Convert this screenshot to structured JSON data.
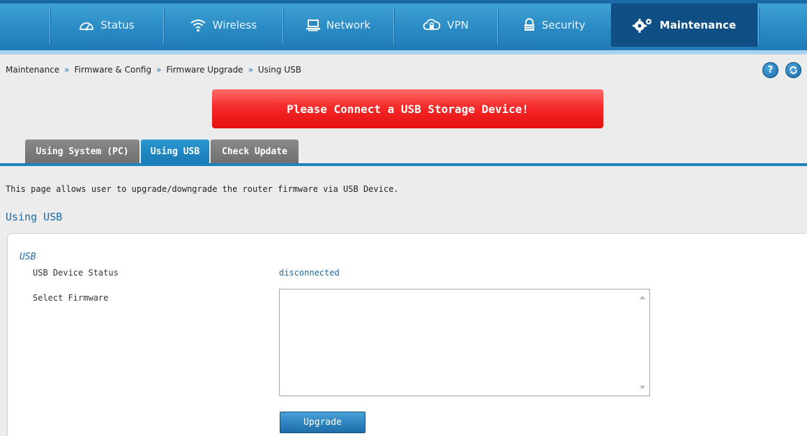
{
  "nav": {
    "items": [
      {
        "label": "Status",
        "icon": "speedometer-icon"
      },
      {
        "label": "Wireless",
        "icon": "wifi-icon"
      },
      {
        "label": "Network",
        "icon": "monitor-icon"
      },
      {
        "label": "VPN",
        "icon": "cloud-lock-icon"
      },
      {
        "label": "Security",
        "icon": "lock-icon"
      },
      {
        "label": "Maintenance",
        "icon": "gears-icon",
        "active": true
      }
    ]
  },
  "breadcrumb": {
    "items": [
      "Maintenance",
      "Firmware & Config",
      "Firmware Upgrade",
      "Using USB"
    ],
    "separator": "»"
  },
  "header_buttons": {
    "help": "?",
    "refresh_icon": "refresh-icon"
  },
  "alert": {
    "text": "Please Connect a USB Storage Device!"
  },
  "tabs": [
    {
      "label": "Using System (PC)",
      "active": false
    },
    {
      "label": "Using USB",
      "active": true
    },
    {
      "label": "Check Update",
      "active": false
    }
  ],
  "page": {
    "description": "This page allows user to upgrade/downgrade the router firmware via USB Device.",
    "section_title": "Using USB"
  },
  "form": {
    "group_title": "USB",
    "usb_status_label": "USB Device Status",
    "usb_status_value": "disconnected",
    "select_firmware_label": "Select Firmware",
    "firmware_options": [],
    "upgrade_button": "Upgrade"
  },
  "colors": {
    "nav_bg": "#2a8ac4",
    "nav_active": "#0f4f86",
    "alert_red": "#f52a2a",
    "tab_active": "#1a83bd",
    "tab_inactive": "#7a7a7a",
    "link_blue": "#1a6aa5"
  }
}
